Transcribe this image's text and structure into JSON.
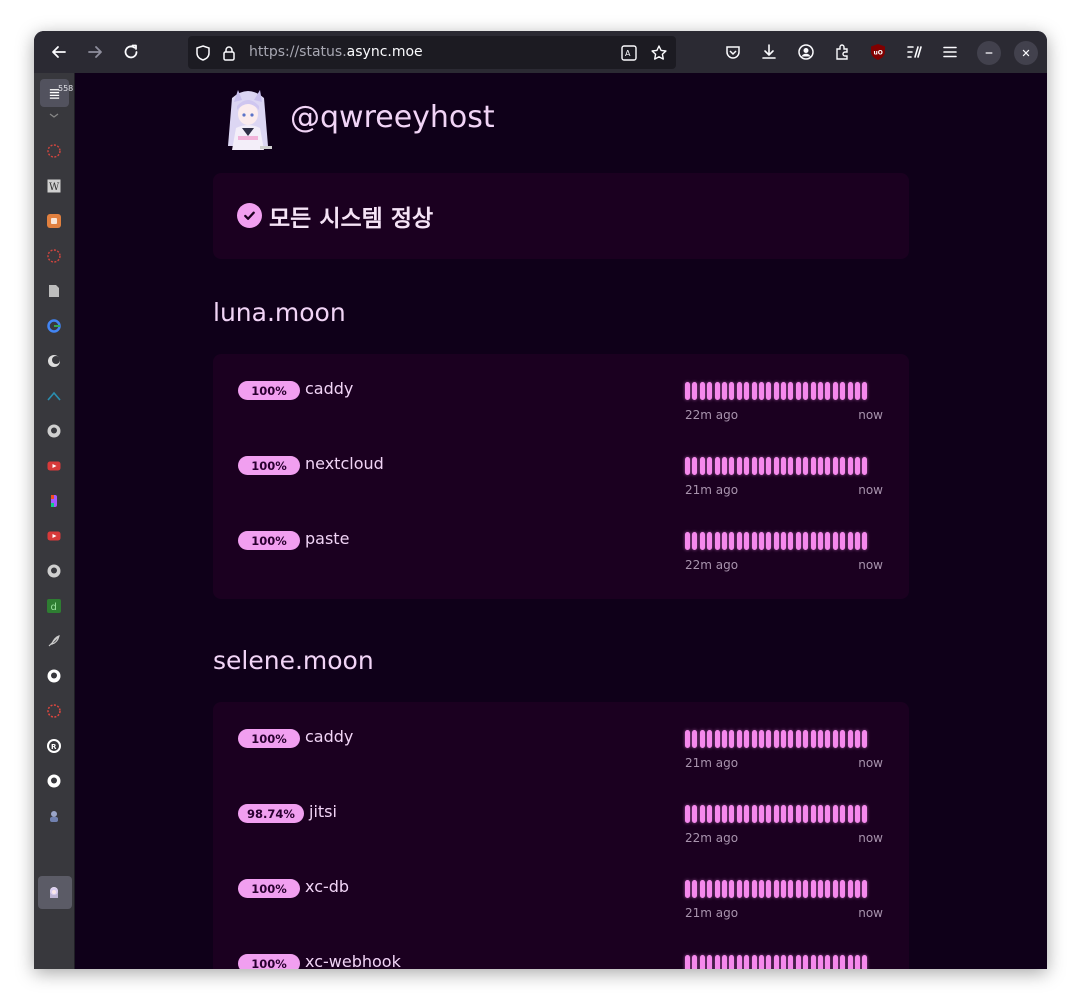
{
  "browser": {
    "url_prefix": "https://status.",
    "url_domain": "async.moe",
    "tab_count": "558"
  },
  "page": {
    "handle": "@qwreeyhost",
    "status_banner": "모든 시스템 정상",
    "accent_color": "#f19ff0"
  },
  "groups": [
    {
      "name": "luna.moon",
      "services": [
        {
          "uptime": "100%",
          "name": "caddy",
          "since": "22m ago",
          "until": "now"
        },
        {
          "uptime": "100%",
          "name": "nextcloud",
          "since": "21m ago",
          "until": "now"
        },
        {
          "uptime": "100%",
          "name": "paste",
          "since": "22m ago",
          "until": "now"
        }
      ]
    },
    {
      "name": "selene.moon",
      "services": [
        {
          "uptime": "100%",
          "name": "caddy",
          "since": "21m ago",
          "until": "now"
        },
        {
          "uptime": "98.74%",
          "name": "jitsi",
          "since": "22m ago",
          "until": "now"
        },
        {
          "uptime": "100%",
          "name": "xc-db",
          "since": "21m ago",
          "until": "now"
        },
        {
          "uptime": "100%",
          "name": "xc-webhook",
          "since": "",
          "until": ""
        }
      ]
    }
  ]
}
